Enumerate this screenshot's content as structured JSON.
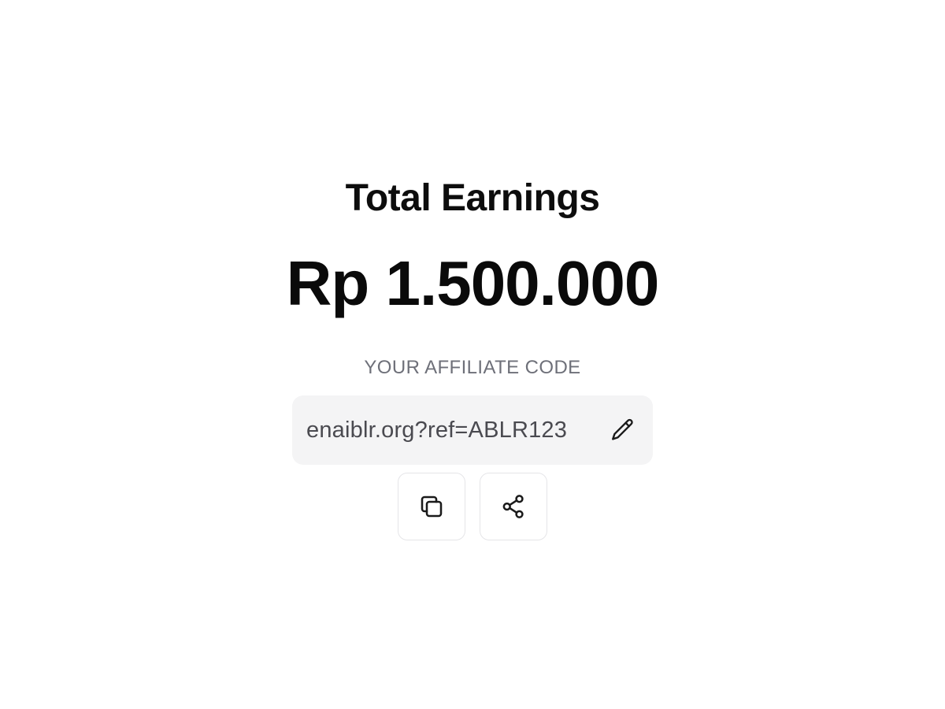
{
  "earnings": {
    "title": "Total Earnings",
    "amount": "Rp 1.500.000"
  },
  "affiliate": {
    "label": "YOUR AFFILIATE CODE",
    "code": "enaiblr.org?ref=ABLR123",
    "edit_icon": "pencil-icon"
  },
  "actions": {
    "copy_icon": "copy-icon",
    "share_icon": "share-icon"
  },
  "colors": {
    "background": "#ffffff",
    "text_primary": "#0a0a0a",
    "label_gray": "#6e7079",
    "code_box_bg": "#f4f4f5",
    "button_border": "#e5e5e8"
  }
}
